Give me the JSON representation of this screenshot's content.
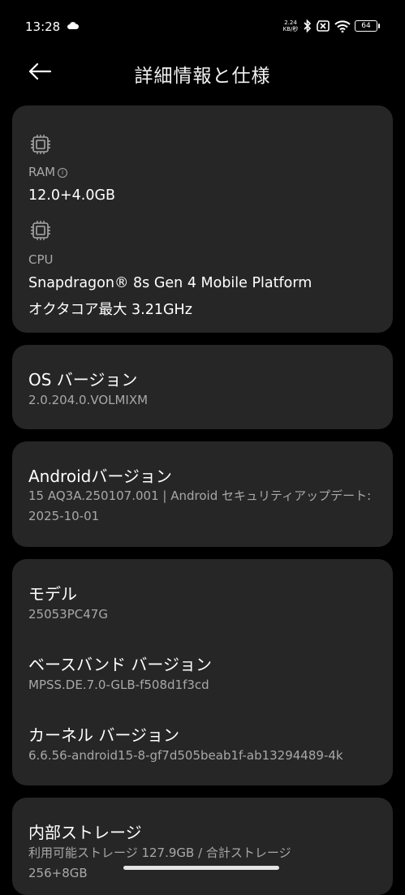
{
  "status_bar": {
    "time": "13:28",
    "net_speed_value": "2.24",
    "net_speed_unit": "KB/秒",
    "battery": "64"
  },
  "header": {
    "title": "詳細情報と仕様"
  },
  "specs": {
    "ram": {
      "label": "RAM",
      "info_mark": "i",
      "value": "12.0+4.0GB"
    },
    "cpu": {
      "label": "CPU",
      "value_line1": "Snapdragon® 8s Gen 4 Mobile Platform",
      "value_line2": "オクタコア最大 3.21GHz"
    }
  },
  "os_version": {
    "title": "OS バージョン",
    "value": "2.0.204.0.VOLMIXM"
  },
  "android_version": {
    "title": "Androidバージョン",
    "value": "15 AQ3A.250107.001 | Android セキュリティアップデート: 2025-10-01"
  },
  "device_info": {
    "model": {
      "title": "モデル",
      "value": "25053PC47G"
    },
    "baseband": {
      "title": "ベースバンド バージョン",
      "value": "MPSS.DE.7.0-GLB-f508d1f3cd"
    },
    "kernel": {
      "title": "カーネル バージョン",
      "value": "6.6.56-android15-8-gf7d505beab1f-ab13294489-4k"
    }
  },
  "storage": {
    "title": "内部ストレージ",
    "value": "利用可能ストレージ 127.9GB / 合計ストレージ 256+8GB"
  },
  "icons": {
    "back": "arrow-left-icon",
    "chip": "chip-icon",
    "weather": "cloud-icon",
    "bluetooth": "bluetooth-icon",
    "sim": "no-sim-icon",
    "wifi": "wifi-icon",
    "battery": "battery-icon"
  },
  "colors": {
    "background": "#000000",
    "card": "#262626",
    "secondary_text": "#a8a8a8"
  }
}
